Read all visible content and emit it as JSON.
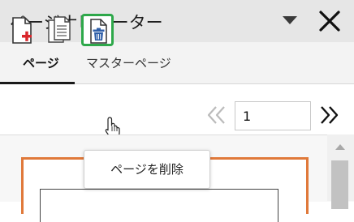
{
  "panel": {
    "title": "ページナビゲーター"
  },
  "tabs": [
    {
      "label": "ページ",
      "active": true
    },
    {
      "label": "マスターページ",
      "active": false
    }
  ],
  "toolbar": {
    "add_page_icon": "add-page-icon",
    "duplicate_page_icon": "duplicate-page-icon",
    "delete_page_icon": "delete-page-icon"
  },
  "navigation": {
    "page_number": "1"
  },
  "tooltip": {
    "text": "ページを削除"
  },
  "colors": {
    "highlight_border": "#2ea84a",
    "page_thumb_border": "#e0793a",
    "add_icon_red": "#d9262b",
    "trash_blue": "#2f5fa8"
  }
}
